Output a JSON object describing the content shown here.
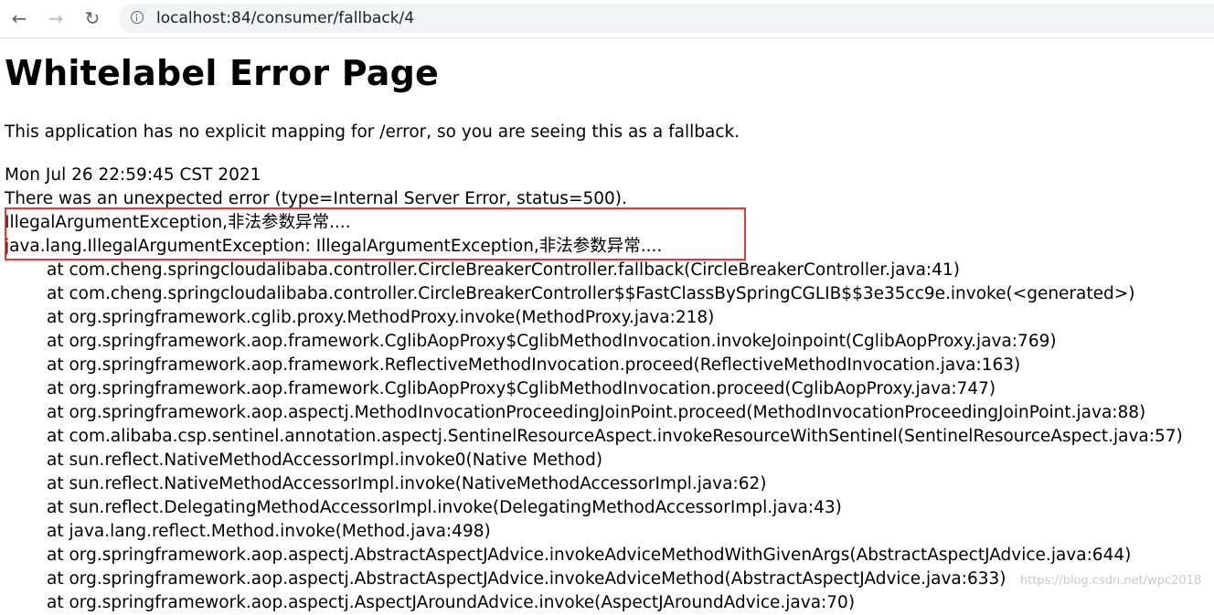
{
  "browser": {
    "url": "localhost:84/consumer/fallback/4",
    "back_icon": "arrow-left",
    "forward_icon": "arrow-right",
    "reload_icon": "reload",
    "info_icon": "info-circle"
  },
  "page": {
    "title": "Whitelabel Error Page",
    "description": "This application has no explicit mapping for /error, so you are seeing this as a fallback.",
    "timestamp": "Mon Jul 26 22:59:45 CST 2021",
    "error_summary": "There was an unexpected error (type=Internal Server Error, status=500).",
    "exception_message": "IllegalArgumentException,非法参数异常....",
    "exception_class_line": "java.lang.IllegalArgumentException: IllegalArgumentException,非法参数异常....",
    "highlight_color": "#e53935",
    "stack_trace": [
      "at com.cheng.springcloudalibaba.controller.CircleBreakerController.fallback(CircleBreakerController.java:41)",
      "at com.cheng.springcloudalibaba.controller.CircleBreakerController$$FastClassBySpringCGLIB$$3e35cc9e.invoke(<generated>)",
      "at org.springframework.cglib.proxy.MethodProxy.invoke(MethodProxy.java:218)",
      "at org.springframework.aop.framework.CglibAopProxy$CglibMethodInvocation.invokeJoinpoint(CglibAopProxy.java:769)",
      "at org.springframework.aop.framework.ReflectiveMethodInvocation.proceed(ReflectiveMethodInvocation.java:163)",
      "at org.springframework.aop.framework.CglibAopProxy$CglibMethodInvocation.proceed(CglibAopProxy.java:747)",
      "at org.springframework.aop.aspectj.MethodInvocationProceedingJoinPoint.proceed(MethodInvocationProceedingJoinPoint.java:88)",
      "at com.alibaba.csp.sentinel.annotation.aspectj.SentinelResourceAspect.invokeResourceWithSentinel(SentinelResourceAspect.java:57)",
      "at sun.reflect.NativeMethodAccessorImpl.invoke0(Native Method)",
      "at sun.reflect.NativeMethodAccessorImpl.invoke(NativeMethodAccessorImpl.java:62)",
      "at sun.reflect.DelegatingMethodAccessorImpl.invoke(DelegatingMethodAccessorImpl.java:43)",
      "at java.lang.reflect.Method.invoke(Method.java:498)",
      "at org.springframework.aop.aspectj.AbstractAspectJAdvice.invokeAdviceMethodWithGivenArgs(AbstractAspectJAdvice.java:644)",
      "at org.springframework.aop.aspectj.AbstractAspectJAdvice.invokeAdviceMethod(AbstractAspectJAdvice.java:633)",
      "at org.springframework.aop.aspectj.AspectJAroundAdvice.invoke(AspectJAroundAdvice.java:70)"
    ]
  },
  "watermark": "https://blog.csdn.net/wpc2018"
}
